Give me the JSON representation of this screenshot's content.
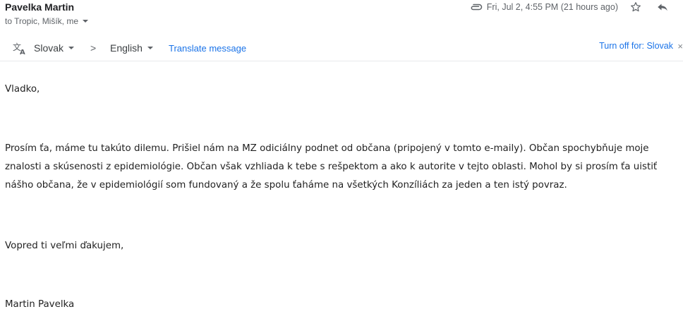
{
  "header": {
    "sender": "Pavelka Martin",
    "recipients": "to Tropic, Mišík, me",
    "date": "Fri, Jul 2, 4:55 PM (21 hours ago)",
    "attachment_icon": "paperclip-icon",
    "star_icon": "star-outline-icon",
    "reply_icon": "reply-icon"
  },
  "translate": {
    "icon": "translate-icon",
    "from_lang": "Slovak",
    "arrow": ">",
    "to_lang": "English",
    "translate_link": "Translate message",
    "turn_off": "Turn off for: Slovak",
    "close": "×"
  },
  "body": {
    "greeting": "Vladko,",
    "paragraph_lines": [
      "Prosím ťa, máme tu takúto dilemu. Prišiel nám na MZ odiciálny podnet od občana (pripojený v tomto e-maily). Občan spochybňuje moje",
      "znalosti a skúsenosti z epidemiológie. Občan však vzhliada k tebe s rešpektom a ako k autorite v tejto oblasti. Mohol by si prosím ťa uistiť",
      "nášho občana, že v epidemiológií som fundovaný a že spolu ťaháme na všetkých Konzíliách za jeden a ten istý povraz."
    ],
    "thanks": "Vopred ti veľmi ďakujem,",
    "signature": "Martin Pavelka"
  },
  "colors": {
    "link": "#1a73e8",
    "muted": "#5f6368",
    "text": "#222222"
  }
}
